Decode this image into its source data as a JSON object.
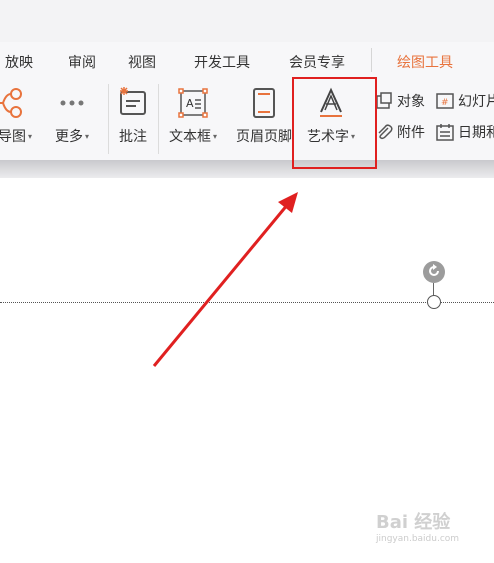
{
  "tabs": [
    {
      "label": "放映",
      "active": false
    },
    {
      "label": "审阅",
      "active": false
    },
    {
      "label": "视图",
      "active": false
    },
    {
      "label": "开发工具",
      "active": false
    },
    {
      "label": "会员专享",
      "active": false
    },
    {
      "label": "绘图工具",
      "active": true
    }
  ],
  "ribbon": {
    "mindmap_label": "维导图",
    "more_label": "更多",
    "comment_label": "批注",
    "textbox_label": "文本框",
    "header_footer_label": "页眉页脚",
    "wordart_label": "艺术字",
    "object_label": "对象",
    "slide_label": "幻灯片",
    "attachment_label": "附件",
    "datetime_label": "日期和"
  },
  "watermark": {
    "logo": "Bai 经验",
    "url": "jingyan.baidu.com"
  },
  "icons": [
    "mindmap-icon",
    "more-icon",
    "comment-icon",
    "textbox-icon",
    "header-footer-icon",
    "wordart-icon",
    "object-icon",
    "slide-number-icon",
    "paperclip-icon",
    "calendar-icon",
    "rotate-icon"
  ],
  "colors": {
    "accent": "#e8733d",
    "highlight": "#e02020"
  }
}
